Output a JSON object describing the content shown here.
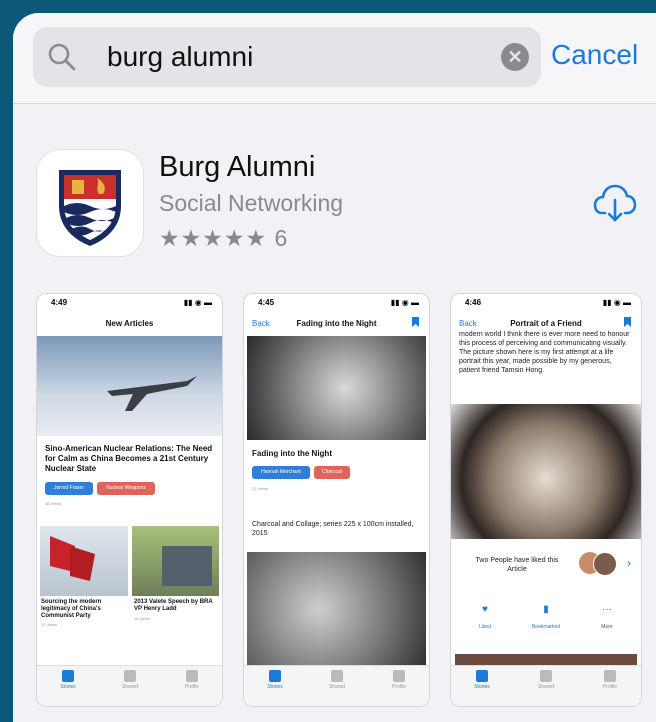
{
  "search": {
    "query": "burg alumni",
    "cancel_label": "Cancel"
  },
  "app": {
    "name": "Burg Alumni",
    "category": "Social Networking",
    "stars": "★★★★★",
    "rating_count": "6"
  },
  "screenshots": [
    {
      "time": "4:49",
      "title": "New Articles",
      "article_title": "Sino-American Nuclear Relations: The Need for Calm as China Becomes a 21st Century Nuclear State",
      "tag1": "Jarrod Fraser",
      "tag2": "Nuclear Weapons",
      "views": "46 Views",
      "card1_title": "Sourcing the modern legitimacy of China's Communist Party",
      "card1_views": "17 Views",
      "card2_title": "2013 Valete Speech by BRA VP Henry Ladd",
      "card2_views": "16 Views",
      "tabs": [
        "Stories",
        "Shared",
        "Profile"
      ]
    },
    {
      "time": "4:45",
      "back": "Back",
      "title": "Fading into the Night",
      "article_title": "Fading into the Night",
      "tag1": "Hannah Merchant",
      "tag2": "Charcoal",
      "views": "32 Views",
      "description": "Charcoal and Collage; series 225 x 100cm installed, 2015",
      "tabs": [
        "Stories",
        "Shared",
        "Profile"
      ]
    },
    {
      "time": "4:46",
      "back": "Back",
      "title": "Portrait of a Friend",
      "body": "modern world I think there is ever more need to honour this process of perceiving and communicating visually. The picture shown here is my first attempt at a life portrait this year, made possible by my generous, patient friend Tamsin Hong.",
      "likes_text": "Two People have liked this Article",
      "actions": [
        "Liked",
        "Bookmarked",
        "More"
      ],
      "tabs": [
        "Stories",
        "Shared",
        "Profile"
      ]
    }
  ],
  "colors": {
    "accent": "#1a7bd8",
    "tag_blue": "#2f7fd9",
    "tag_red": "#e0645a"
  }
}
